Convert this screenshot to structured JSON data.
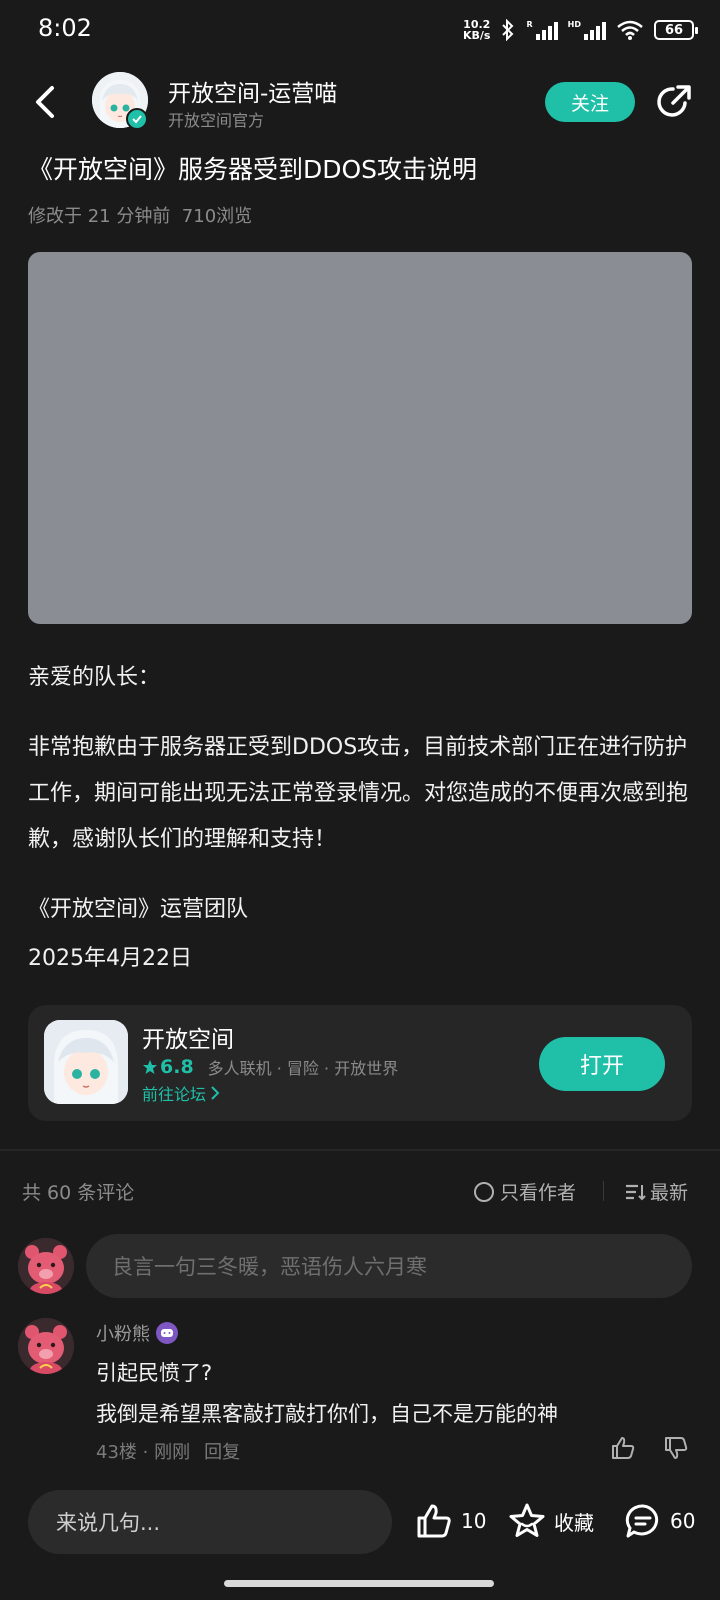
{
  "status_bar": {
    "time": "8:02",
    "net_speed_value": "10.2",
    "net_speed_unit": "KB/s",
    "signal1_label": "R",
    "signal2_label": "HD",
    "battery": "66"
  },
  "header": {
    "author_name": "开放空间-运营喵",
    "author_subtitle": "开放空间官方",
    "follow_label": "关注"
  },
  "post": {
    "title": "《开放空间》服务器受到DDOS攻击说明",
    "meta": "修改于 21 分钟前  710浏览",
    "greeting": "亲爱的队长：",
    "body": "非常抱歉由于服务器正受到DDOS攻击，目前技术部门正在进行防护工作，期间可能出现无法正常登录情况。对您造成的不便再次感到抱歉，感谢队长们的理解和支持！",
    "signature": "《开放空间》运营团队",
    "date": "2025年4月22日"
  },
  "game_card": {
    "name": "开放空间",
    "rating": "6.8",
    "tags": "多人联机 · 冒险 · 开放世界",
    "forum_link": "前往论坛",
    "open_label": "打开"
  },
  "comments_header": {
    "count": "共 60 条评论",
    "author_only": "只看作者",
    "sort": "最新"
  },
  "comment_input_placeholder": "良言一句三冬暖，恶语伤人六月寒",
  "comments": [
    {
      "user": "小粉熊",
      "line1": "引起民愤了?",
      "line2": "我倒是希望黑客敲打敲打你们，自己不是万能的神",
      "floor": "43楼 · 刚刚",
      "reply": "回复"
    }
  ],
  "bottom_bar": {
    "input_placeholder": "来说几句...",
    "like_count": "10",
    "favorite_label": "收藏",
    "comment_count": "60"
  },
  "colors": {
    "accent": "#1fbfa8",
    "background": "#1a1a1a",
    "card": "#262626"
  }
}
